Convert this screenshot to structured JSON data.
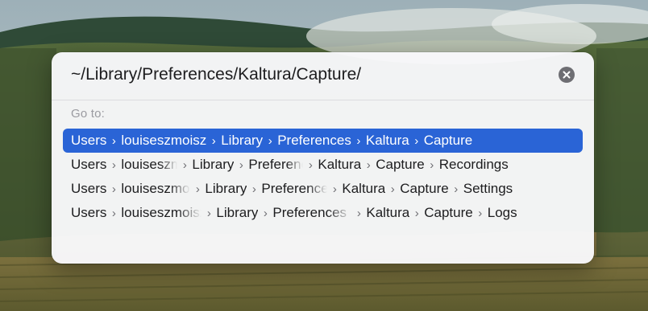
{
  "go_to_panel": {
    "path_value": "~/Library/Preferences/Kaltura/Capture/",
    "clear_icon": "xmark-circle-icon",
    "section_label": "Go to:",
    "suggestions": [
      {
        "selected": true,
        "segments": [
          "Users",
          "louiseszmoisz",
          "Library",
          "Preferences",
          "Kaltura",
          "Capture"
        ]
      },
      {
        "selected": false,
        "segments": [
          "Users",
          "louiseszmoisz",
          "Library",
          "Preferences",
          "Kaltura",
          "Capture",
          "Recordings"
        ]
      },
      {
        "selected": false,
        "segments": [
          "Users",
          "louiseszmoisz",
          "Library",
          "Preferences",
          "Kaltura",
          "Capture",
          "Settings"
        ]
      },
      {
        "selected": false,
        "segments": [
          "Users",
          "louiseszmoisz",
          "Library",
          "Preferences",
          "Kaltura",
          "Capture",
          "Logs"
        ]
      }
    ],
    "separator": "›",
    "selection_color": "#2a64d6"
  }
}
